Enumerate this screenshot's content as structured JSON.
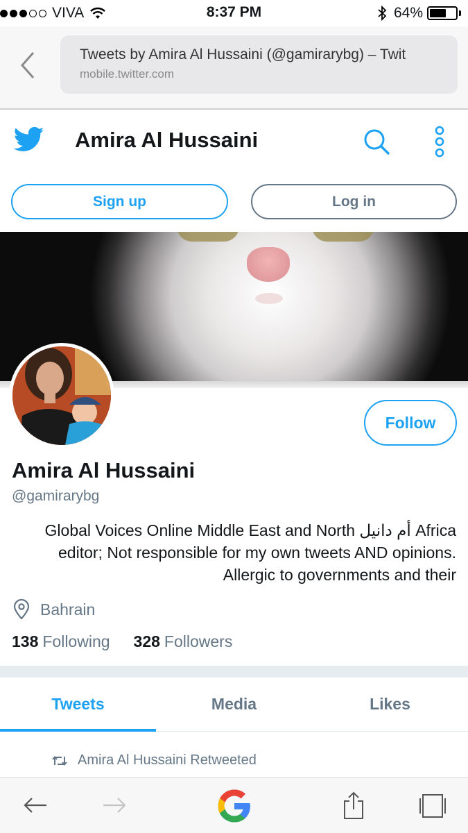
{
  "status_bar": {
    "carrier": "VIVA",
    "time": "8:37 PM",
    "battery": "64%",
    "battery_level": 0.64,
    "signal_dots_filled": 3,
    "signal_dots_total": 5,
    "icons": [
      "wifi-icon",
      "bluetooth-icon",
      "battery-icon"
    ]
  },
  "browser": {
    "page_title": "Tweets by Amira Al Hussaini (@gamirarybg) – Twit",
    "domain": "mobile.twitter.com",
    "icons": [
      "back-arrow-icon"
    ]
  },
  "header": {
    "title": "Amira Al Hussaini",
    "icons": [
      "twitter-bird-icon",
      "search-icon",
      "more-vertical-icon"
    ],
    "accent_color": "#1da1f2"
  },
  "auth": {
    "signup_label": "Sign up",
    "login_label": "Log in"
  },
  "profile": {
    "follow_label": "Follow",
    "name": "Amira Al Hussaini",
    "handle": "@gamirarybg",
    "bio": "Global Voices Online Middle East and North أم دانيل Africa editor; Not responsible for my own tweets AND opinions. Allergic to governments and their",
    "location": "Bahrain",
    "following_count": "138",
    "following_label": "Following",
    "followers_count": "328",
    "followers_label": "Followers"
  },
  "tabs": [
    {
      "label": "Tweets",
      "active": true
    },
    {
      "label": "Media",
      "active": false
    },
    {
      "label": "Likes",
      "active": false
    }
  ],
  "timeline": {
    "retweet_label": "Amira Al Hussaini Retweeted"
  },
  "toolbar": {
    "icons": [
      "back-icon",
      "forward-icon",
      "google-icon",
      "share-icon",
      "tabs-icon"
    ]
  }
}
